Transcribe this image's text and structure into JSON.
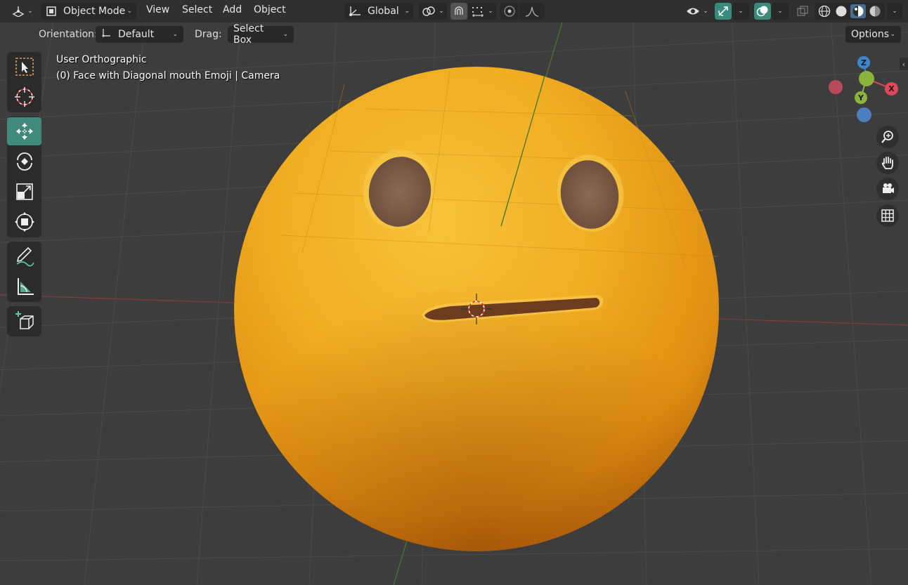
{
  "header": {
    "mode_label": "Object Mode",
    "menus": [
      "View",
      "Select",
      "Add",
      "Object"
    ],
    "transform_orientation": "Global",
    "icons": [
      "editor-type-icon",
      "object-mode-icon",
      "transform-orientation-icon",
      "pivot-point-icon",
      "snap-icon",
      "snap-increment-icon",
      "proportional-editing-icon",
      "falloff-icon",
      "visibility-icon",
      "gizmo-icon",
      "overlay-icon",
      "xray-icon",
      "wireframe-shading-icon",
      "solid-shading-icon",
      "material-preview-icon",
      "rendered-shading-icon"
    ]
  },
  "tool_settings": {
    "orientation_label": "Orientation:",
    "orientation_value": "Default",
    "drag_label": "Drag:",
    "drag_value": "Select Box",
    "options_label": "Options"
  },
  "toolbar": {
    "tools": [
      "select-box",
      "cursor",
      "move",
      "rotate",
      "scale",
      "transform",
      "annotate",
      "measure",
      "add-cube"
    ],
    "active_tool": "move"
  },
  "viewport": {
    "view_name": "User Orthographic",
    "object_info": "(0) Face with Diagonal mouth Emoji | Camera"
  },
  "gizmo": {
    "axes": {
      "x": "X",
      "y": "Y",
      "z": "Z"
    },
    "colors": {
      "x": "#e0485a",
      "y": "#8ab43b",
      "z": "#3b86cf"
    },
    "nav_buttons": [
      "zoom",
      "pan",
      "camera-view",
      "perspective-toggle"
    ]
  },
  "colors": {
    "header_bg": "#303030",
    "viewport_bg": "#3d3d3d",
    "accent_teal": "#3f8a7a",
    "emoji_yellow": "#f0a91c"
  }
}
